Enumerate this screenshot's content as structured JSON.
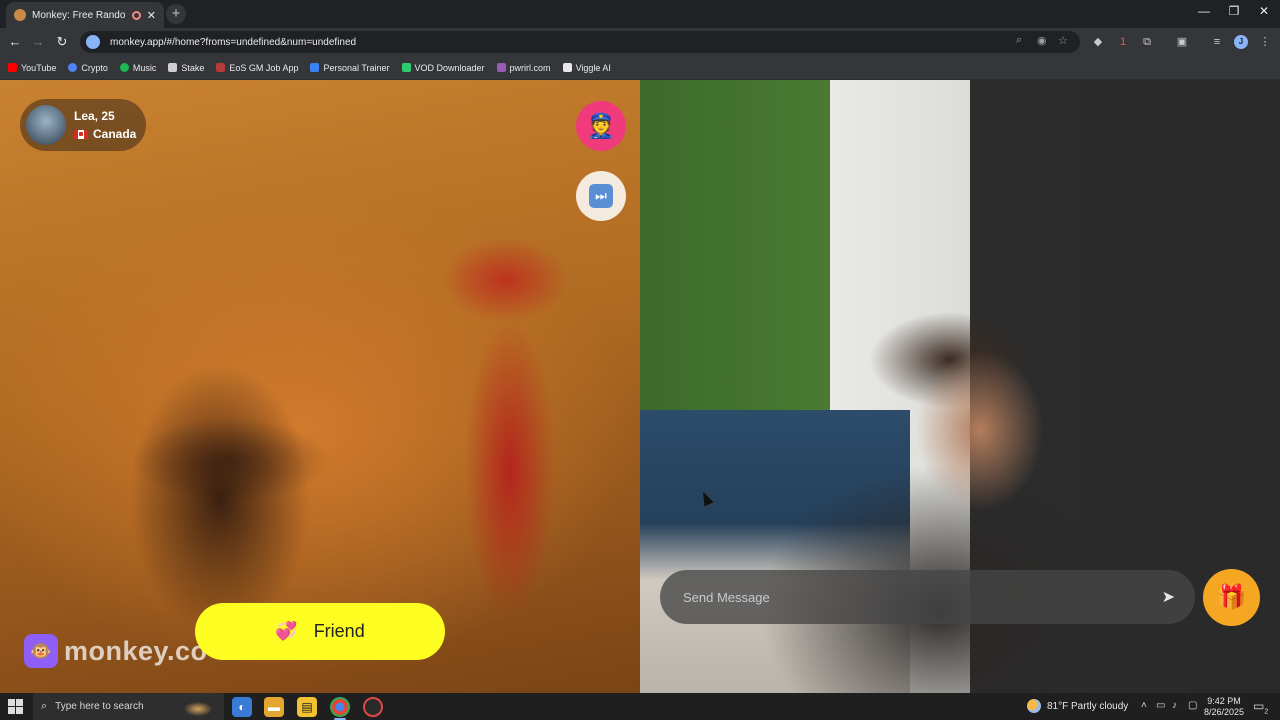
{
  "browser": {
    "tab_title": "Monkey: Free Random Vide",
    "tab_close": "✕",
    "new_tab": "+",
    "url": "monkey.app/#/home?froms=undefined&num=undefined",
    "window_controls": {
      "minimize": "—",
      "restore": "❐",
      "close": "✕"
    },
    "profile_initial": "J",
    "extension_badge": "1"
  },
  "bookmarks": [
    {
      "label": "YouTube",
      "color": "#ff0000"
    },
    {
      "label": "Crypto",
      "color": "#4f83f5"
    },
    {
      "label": "Music",
      "color": "#1db954"
    },
    {
      "label": "Stake",
      "color": "#cfcfcf"
    },
    {
      "label": "EoS GM Job App",
      "color": "#b33b3b"
    },
    {
      "label": "Personal Trainer",
      "color": "#3b82f6"
    },
    {
      "label": "VOD Downloader",
      "color": "#2ecc71"
    },
    {
      "label": "pwrirl.com",
      "color": "#9b59b6"
    },
    {
      "label": "Viggle AI",
      "color": "#e8e8e8"
    }
  ],
  "match": {
    "name_age": "Lea, 25",
    "country": "Canada"
  },
  "icons": {
    "report": "👮",
    "skip": "⏭",
    "gift": "🎁",
    "heart": "💞",
    "send": "➤",
    "logo_mark": "🐵"
  },
  "logo": {
    "text": "monkey.co"
  },
  "friend_button": {
    "label": "Friend"
  },
  "chat": {
    "placeholder": "Send Message"
  },
  "taskbar": {
    "search_placeholder": "Type here to search",
    "weather": "81°F  Partly cloudy",
    "time": "9:42 PM",
    "date": "8/26/2025",
    "notification_count": "2"
  },
  "colors": {
    "friend_button": "#fdfd22",
    "report_button": "#f03a7c",
    "gift_button": "#f5a623",
    "logo_mark": "#8e5ef5"
  }
}
